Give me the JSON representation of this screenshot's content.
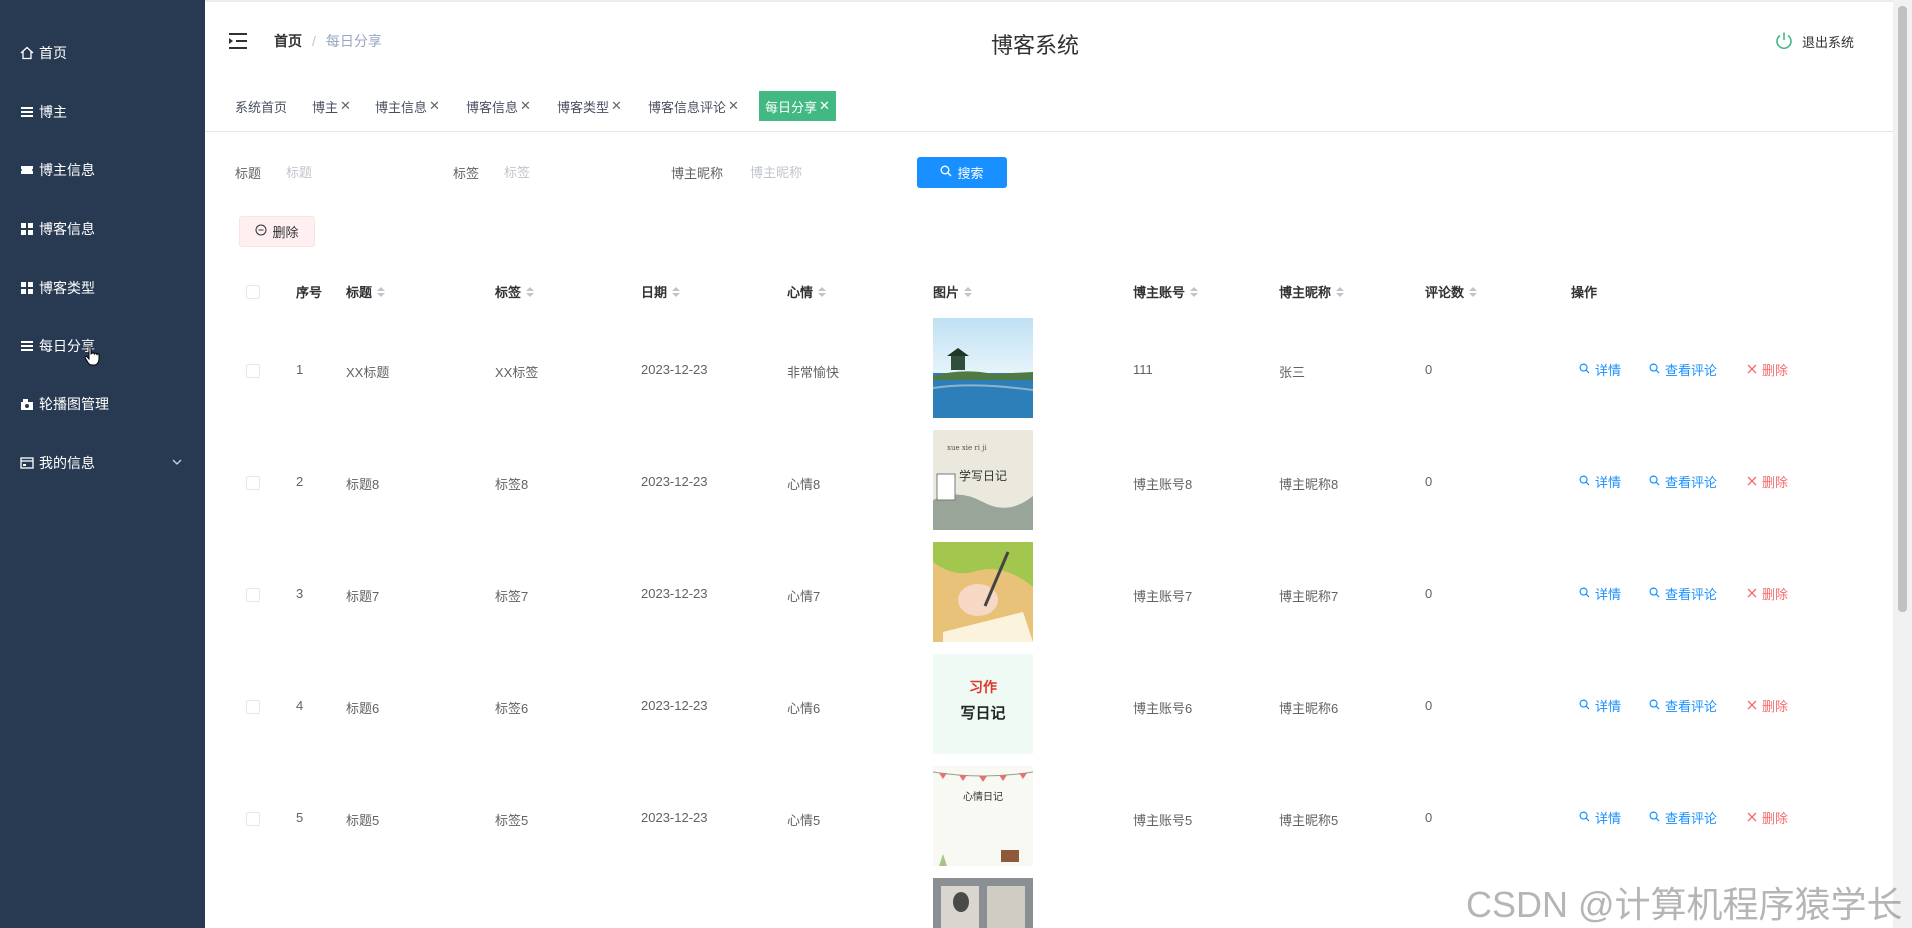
{
  "sidebar": {
    "items": [
      {
        "label": "首页",
        "icon": "home-icon"
      },
      {
        "label": "博主",
        "icon": "list-icon"
      },
      {
        "label": "博主信息",
        "icon": "ticket-icon"
      },
      {
        "label": "博客信息",
        "icon": "grid-icon"
      },
      {
        "label": "博客类型",
        "icon": "grid-icon"
      },
      {
        "label": "每日分享",
        "icon": "list-icon"
      },
      {
        "label": "轮播图管理",
        "icon": "camera-icon"
      },
      {
        "label": "我的信息",
        "icon": "card-icon"
      }
    ]
  },
  "header": {
    "breadcrumb": {
      "home": "首页",
      "separator": "/",
      "current": "每日分享"
    },
    "title": "博客系统",
    "logout_label": "退出系统"
  },
  "tabs": [
    {
      "label": "系统首页",
      "closable": false
    },
    {
      "label": "博主",
      "closable": true
    },
    {
      "label": "博主信息",
      "closable": true
    },
    {
      "label": "博客信息",
      "closable": true
    },
    {
      "label": "博客类型",
      "closable": true
    },
    {
      "label": "博客信息评论",
      "closable": true
    },
    {
      "label": "每日分享",
      "closable": true,
      "active": true
    }
  ],
  "search": {
    "title_label": "标题",
    "title_placeholder": "标题",
    "tag_label": "标签",
    "tag_placeholder": "标签",
    "nick_label": "博主昵称",
    "nick_placeholder": "博主昵称",
    "search_button": "搜索"
  },
  "toolbar": {
    "delete_label": "删除"
  },
  "table": {
    "headers": [
      "序号",
      "标题",
      "标签",
      "日期",
      "心情",
      "图片",
      "博主账号",
      "博主昵称",
      "评论数",
      "操作"
    ],
    "rows": [
      {
        "idx": "1",
        "title": "XX标题",
        "tag": "XX标签",
        "date": "2023-12-23",
        "mood": "非常愉快",
        "account": "111",
        "nick": "张三",
        "comments": "0"
      },
      {
        "idx": "2",
        "title": "标题8",
        "tag": "标签8",
        "date": "2023-12-23",
        "mood": "心情8",
        "account": "博主账号8",
        "nick": "博主昵称8",
        "comments": "0"
      },
      {
        "idx": "3",
        "title": "标题7",
        "tag": "标签7",
        "date": "2023-12-23",
        "mood": "心情7",
        "account": "博主账号7",
        "nick": "博主昵称7",
        "comments": "0"
      },
      {
        "idx": "4",
        "title": "标题6",
        "tag": "标签6",
        "date": "2023-12-23",
        "mood": "心情6",
        "account": "博主账号6",
        "nick": "博主昵称6",
        "comments": "0"
      },
      {
        "idx": "5",
        "title": "标题5",
        "tag": "标签5",
        "date": "2023-12-23",
        "mood": "心情5",
        "account": "博主账号5",
        "nick": "博主昵称5",
        "comments": "0"
      }
    ],
    "actions": {
      "detail": "详情",
      "view_comments": "查看评论",
      "delete": "删除"
    },
    "thumb_texts": {
      "t2": "学写日记",
      "t4a": "习作",
      "t4b": "写日记",
      "t5": "心情日记"
    }
  },
  "watermark": "CSDN @计算机程序猿学长",
  "colors": {
    "sidebar": "#283a52",
    "active_tab": "#42b983",
    "primary": "#1890ff",
    "danger": "#f56c6c"
  }
}
